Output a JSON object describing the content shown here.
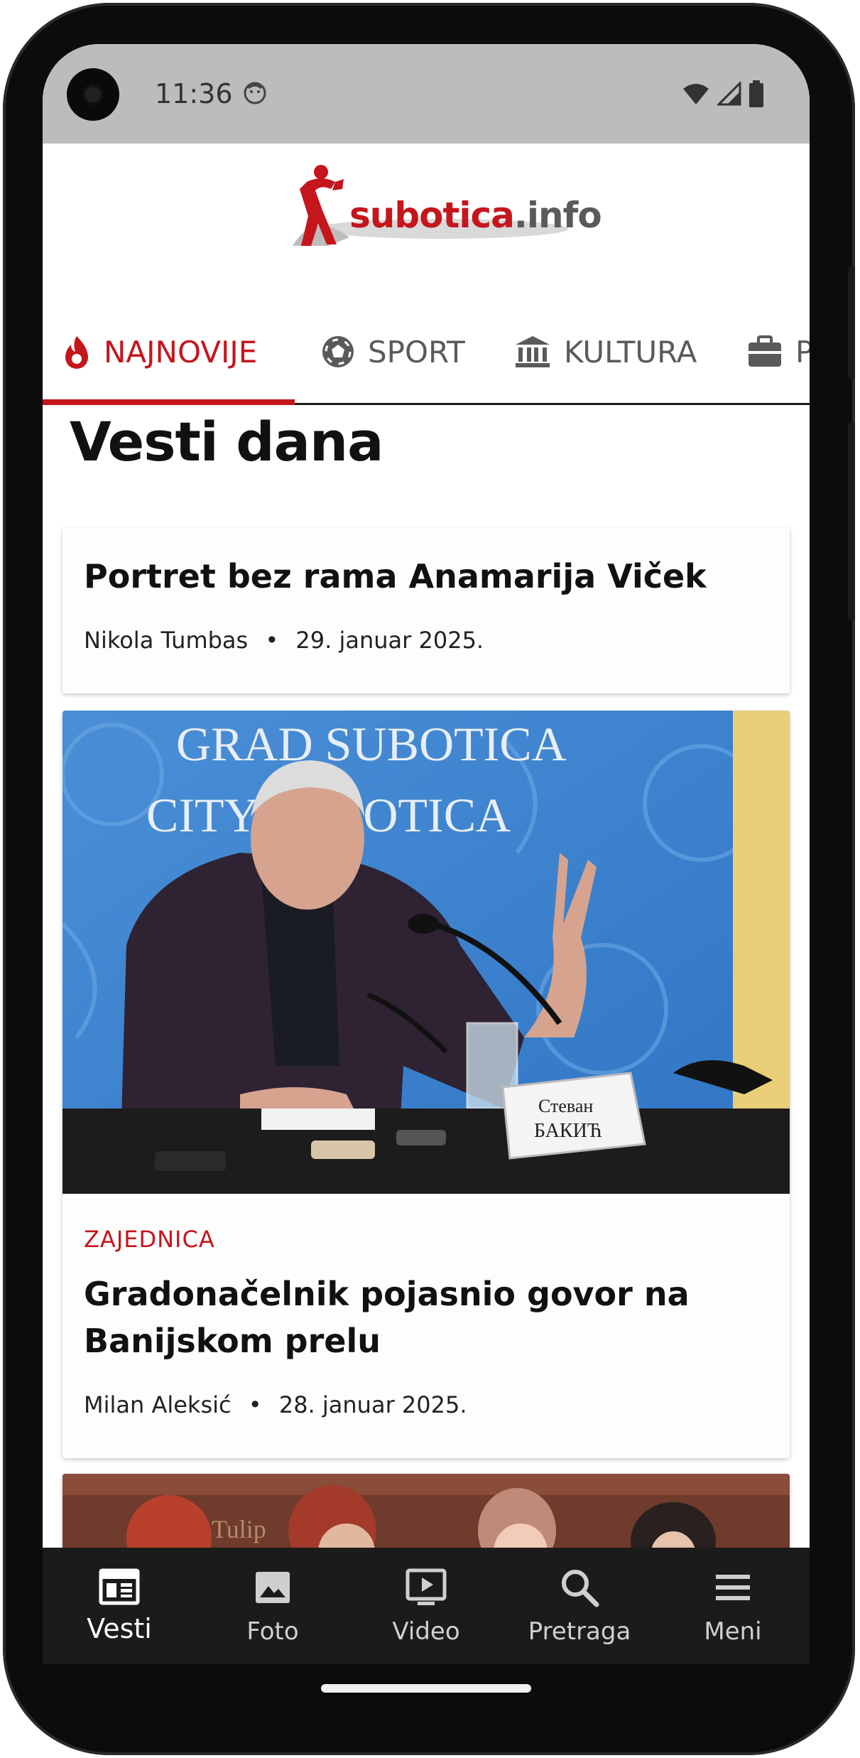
{
  "status_bar": {
    "time": "11:36"
  },
  "logo": {
    "brand": "subotica",
    "suffix": ".info"
  },
  "tabs": [
    {
      "label": "NAJNOVIJE",
      "icon": "flame-icon",
      "active": true
    },
    {
      "label": "SPORT",
      "icon": "soccer-ball-icon",
      "active": false
    },
    {
      "label": "KULTURA",
      "icon": "museum-icon",
      "active": false
    },
    {
      "label": "P",
      "icon": "briefcase-icon",
      "active": false
    }
  ],
  "section": {
    "title": "Vesti dana"
  },
  "articles": [
    {
      "title": "Portret bez rama Anamarija Viček",
      "author": "Nikola Tumbas",
      "separator": "•",
      "date": "29. januar 2025."
    },
    {
      "category": "ZAJEDNICA",
      "title": "Gradonačelnik pojasnio govor na Banijskom prelu",
      "author": "Milan Aleksić",
      "separator": "•",
      "date": "28. januar 2025.",
      "photo": {
        "banner_line1": "GRAD SUBOTICA",
        "banner_line2": "CITY SUBOTICA",
        "nameplate_line1": "Стеван",
        "nameplate_line2": "БАКИЋ"
      }
    },
    {
      "photo": {
        "sign_text": "Tulip"
      }
    }
  ],
  "bottom_nav": [
    {
      "label": "Vesti",
      "icon": "newspaper-icon",
      "active": true
    },
    {
      "label": "Foto",
      "icon": "image-icon",
      "active": false
    },
    {
      "label": "Video",
      "icon": "video-icon",
      "active": false
    },
    {
      "label": "Pretraga",
      "icon": "search-icon",
      "active": false
    },
    {
      "label": "Meni",
      "icon": "menu-icon",
      "active": false
    }
  ],
  "colors": {
    "accent": "#c4161c",
    "nav_bg": "#1b1b1b",
    "status_bar": "#bdbcbd"
  }
}
